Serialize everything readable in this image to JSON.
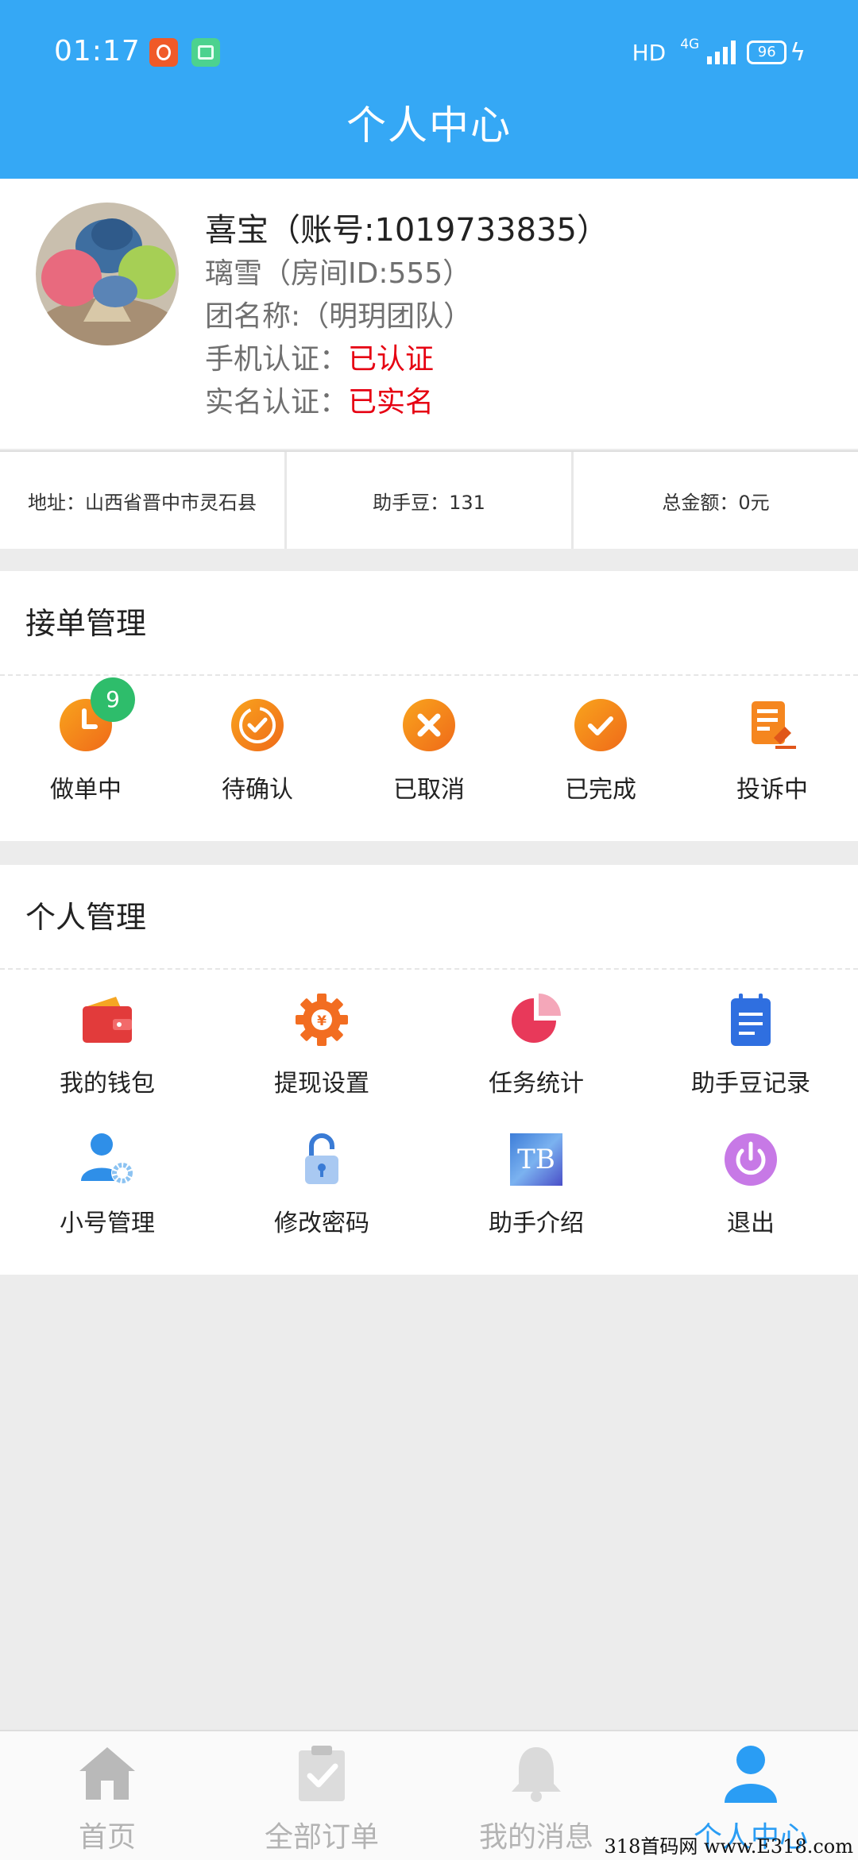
{
  "status_bar": {
    "time": "01:17",
    "hd_label": "HD",
    "network": "4G",
    "battery": "96",
    "app_icons": [
      "kuaishou-app-icon",
      "multitask-app-icon"
    ]
  },
  "header": {
    "title": "个人中心"
  },
  "profile": {
    "name_line": "喜宝（账号:1019733835）",
    "room_line": "璃雪（房间ID:555）",
    "team_line": "团名称:（明玥团队）",
    "phone_label": "手机认证：",
    "phone_status": "已认证",
    "realname_label": "实名认证：",
    "realname_status": "已实名"
  },
  "stats": {
    "address": "地址：山西省晋中市灵石县",
    "beans": "助手豆：131",
    "total": "总金额：0元"
  },
  "order_section": {
    "title": "接单管理",
    "badge": "9",
    "items": [
      {
        "label": "做单中",
        "icon": "clock-icon"
      },
      {
        "label": "待确认",
        "icon": "pending-check-icon"
      },
      {
        "label": "已取消",
        "icon": "cancel-icon"
      },
      {
        "label": "已完成",
        "icon": "check-icon"
      },
      {
        "label": "投诉中",
        "icon": "complaint-icon"
      }
    ]
  },
  "personal_section": {
    "title": "个人管理",
    "items": [
      {
        "label": "我的钱包",
        "icon": "wallet-icon"
      },
      {
        "label": "提现设置",
        "icon": "withdraw-gear-icon"
      },
      {
        "label": "任务统计",
        "icon": "pie-chart-icon"
      },
      {
        "label": "助手豆记录",
        "icon": "notepad-icon"
      },
      {
        "label": "小号管理",
        "icon": "user-gear-icon"
      },
      {
        "label": "修改密码",
        "icon": "unlock-icon"
      },
      {
        "label": "助手介绍",
        "icon": "tb-logo-icon",
        "icon_text": "TB"
      },
      {
        "label": "退出",
        "icon": "power-icon"
      }
    ]
  },
  "tabbar": {
    "items": [
      {
        "label": "首页",
        "icon": "home-icon"
      },
      {
        "label": "全部订单",
        "icon": "clipboard-icon"
      },
      {
        "label": "我的消息",
        "icon": "bell-icon"
      },
      {
        "label": "个人中心",
        "icon": "person-icon",
        "active": true
      }
    ]
  },
  "watermark": "318首码网 www.E318.com",
  "colors": {
    "header_blue": "#35a8f5",
    "orange": "#f07a1a",
    "red_status": "#e60012",
    "active_tab": "#2a9df4",
    "badge_green": "#2ebd6b"
  }
}
